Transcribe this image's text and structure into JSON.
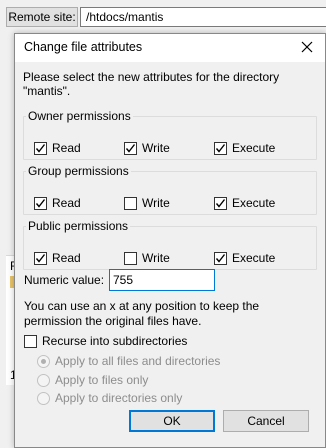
{
  "background": {
    "remote_site_label": "Remote site:",
    "remote_path": "/htdocs/mantis",
    "bg_letter_1": "F",
    "bg_letter_2": "1"
  },
  "dialog": {
    "title": "Change file attributes",
    "intro": "Please select the new attributes for the directory \"mantis\".",
    "groups": [
      {
        "title": "Owner permissions",
        "items": [
          {
            "label": "Read",
            "checked": true
          },
          {
            "label": "Write",
            "checked": true
          },
          {
            "label": "Execute",
            "checked": true
          }
        ]
      },
      {
        "title": "Group permissions",
        "items": [
          {
            "label": "Read",
            "checked": true
          },
          {
            "label": "Write",
            "checked": false
          },
          {
            "label": "Execute",
            "checked": true
          }
        ]
      },
      {
        "title": "Public permissions",
        "items": [
          {
            "label": "Read",
            "checked": true
          },
          {
            "label": "Write",
            "checked": false
          },
          {
            "label": "Execute",
            "checked": true
          }
        ]
      }
    ],
    "numeric_label": "Numeric value:",
    "numeric_value": "755",
    "hint": "You can use an x at any position to keep the permission the original files have.",
    "recurse_label": "Recurse into subdirectories",
    "recurse_checked": false,
    "apply_options": [
      {
        "label": "Apply to all files and directories",
        "selected": true
      },
      {
        "label": "Apply to files only",
        "selected": false
      },
      {
        "label": "Apply to directories only",
        "selected": false
      }
    ],
    "ok_label": "OK",
    "cancel_label": "Cancel"
  }
}
